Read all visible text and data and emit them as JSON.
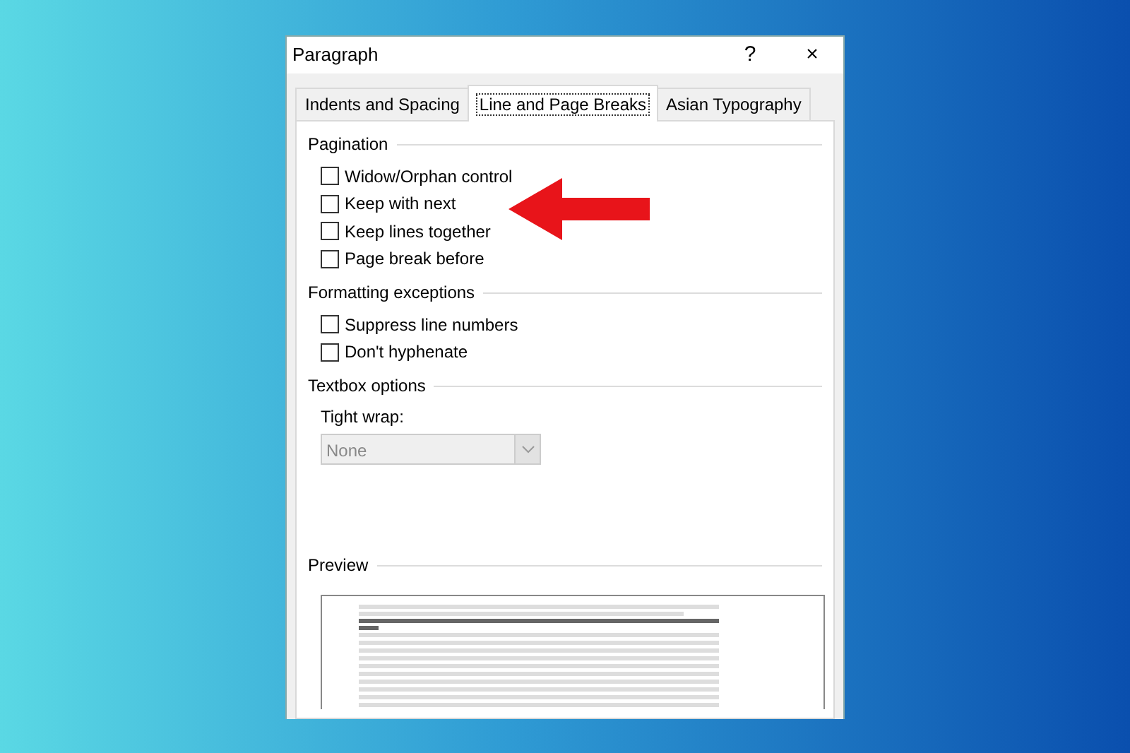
{
  "window": {
    "title": "Paragraph",
    "help": "?",
    "close": "×"
  },
  "tabs": [
    {
      "label": "Indents and Spacing",
      "selected": false
    },
    {
      "label": "Line and Page Breaks",
      "selected": true
    },
    {
      "label": "Asian Typography",
      "selected": false
    }
  ],
  "sections": [
    {
      "title": "Pagination",
      "items": [
        {
          "kind": "checkbox",
          "label": "Widow/Orphan control",
          "checked": false
        },
        {
          "kind": "checkbox",
          "label": "Keep with next",
          "checked": false
        },
        {
          "kind": "checkbox",
          "label": "Keep lines together",
          "checked": false
        },
        {
          "kind": "checkbox",
          "label": "Page break before",
          "checked": false
        }
      ]
    },
    {
      "title": "Formatting exceptions",
      "items": [
        {
          "kind": "checkbox",
          "label": "Suppress line numbers",
          "checked": false
        },
        {
          "kind": "checkbox",
          "label": "Don't hyphenate",
          "checked": false
        }
      ]
    },
    {
      "title": "Textbox options",
      "items": [
        {
          "kind": "dropdown",
          "label": "Tight wrap:",
          "value": "None",
          "disabled": true
        }
      ]
    }
  ],
  "preview": {
    "title": "Preview"
  }
}
